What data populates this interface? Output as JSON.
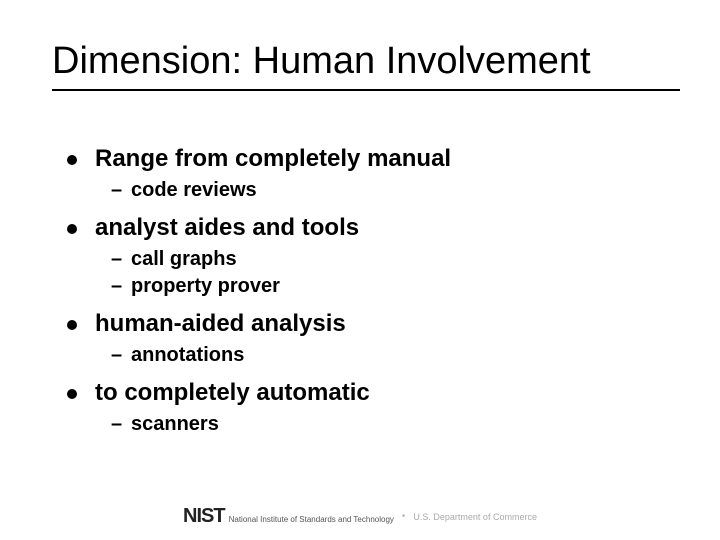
{
  "title": "Dimension: Human Involvement",
  "bullets": [
    {
      "text": "Range from completely manual",
      "sub": [
        "code reviews"
      ]
    },
    {
      "text": "analyst aides and tools",
      "sub": [
        "call graphs",
        "property prover"
      ]
    },
    {
      "text": "human-aided analysis",
      "sub": [
        "annotations"
      ]
    },
    {
      "text": "to completely automatic",
      "sub": [
        "scanners"
      ]
    }
  ],
  "footer": {
    "logo_text": "NIST",
    "logo_sub": "National Institute of Standards and Technology",
    "dept": "U.S. Department of Commerce"
  }
}
